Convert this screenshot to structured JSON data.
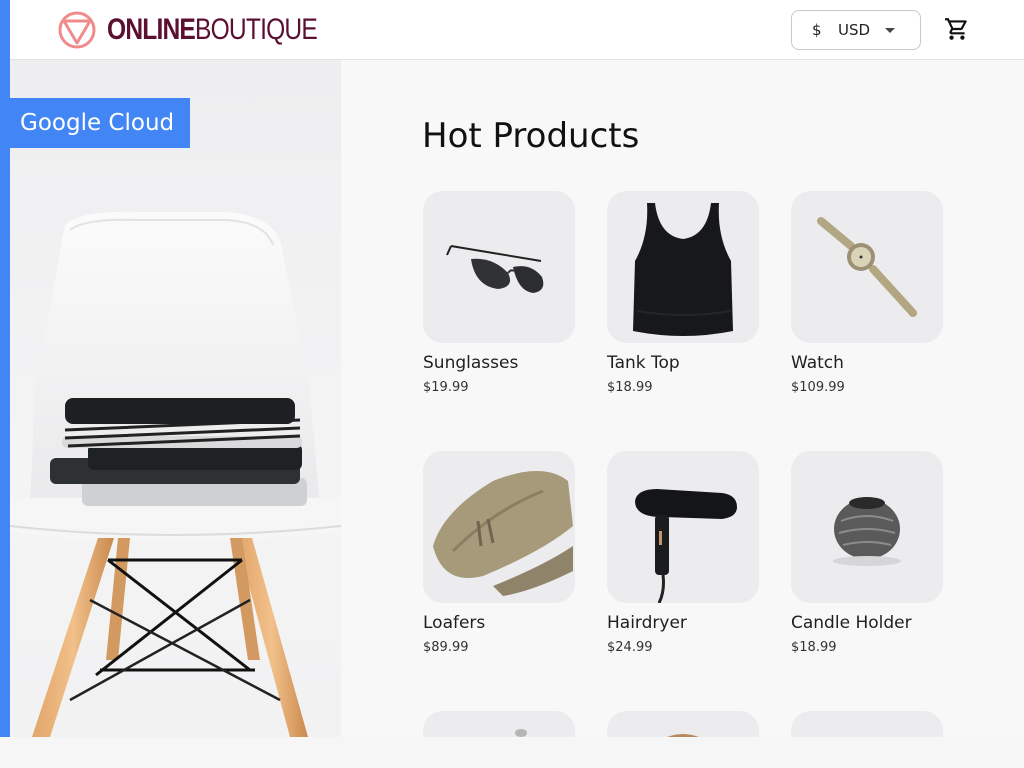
{
  "header": {
    "logo_bold": "ONLINE",
    "logo_light": "BOUTIQUE",
    "currency": {
      "symbol": "$",
      "code": "USD"
    }
  },
  "hero": {
    "badge": "Google Cloud"
  },
  "main": {
    "title": "Hot Products",
    "products": [
      {
        "name": "Sunglasses",
        "price": "$19.99",
        "icon": "sunglasses-image"
      },
      {
        "name": "Tank Top",
        "price": "$18.99",
        "icon": "tank-top-image"
      },
      {
        "name": "Watch",
        "price": "$109.99",
        "icon": "watch-image"
      },
      {
        "name": "Loafers",
        "price": "$89.99",
        "icon": "loafers-image"
      },
      {
        "name": "Hairdryer",
        "price": "$24.99",
        "icon": "hairdryer-image"
      },
      {
        "name": "Candle Holder",
        "price": "$18.99",
        "icon": "candle-holder-image"
      }
    ]
  },
  "colors": {
    "accent": "#4285f4",
    "brand": "#5b1030",
    "logo_mark": "#f08b8b"
  }
}
